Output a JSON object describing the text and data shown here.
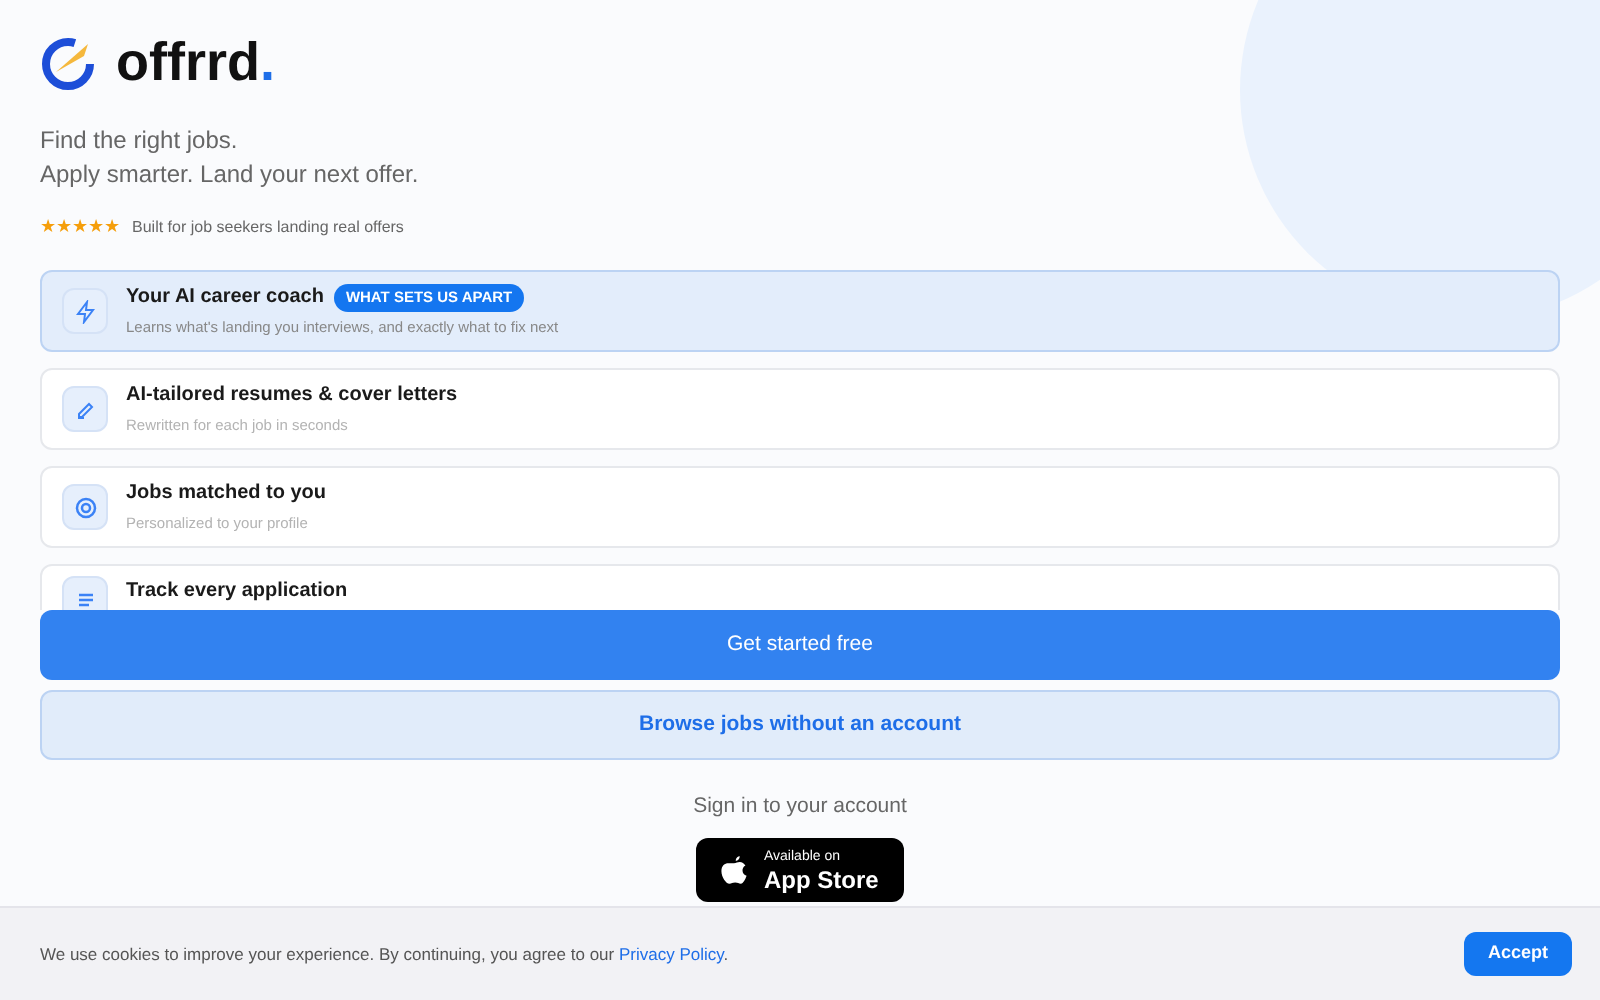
{
  "logo": {
    "name": "offrrd",
    "dot": "."
  },
  "tagline": [
    "Find the right jobs.",
    "Apply smarter. Land your next offer."
  ],
  "rating": {
    "stars": 5,
    "text": "Built for job seekers landing real offers"
  },
  "features": [
    {
      "kind": "bolt",
      "title": "Your AI career coach",
      "badge": "WHAT SETS US APART",
      "subtitle": "Learns what's landing you interviews, and exactly what to fix next",
      "selected": true
    },
    {
      "kind": "pen",
      "title": "AI-tailored resumes & cover letters",
      "subtitle": "Rewritten for each job in seconds",
      "selected": false
    },
    {
      "kind": "target",
      "title": "Jobs matched to you",
      "subtitle": "Personalized to your profile",
      "selected": false
    },
    {
      "kind": "track",
      "title": "Track every application",
      "selected": false
    }
  ],
  "primary_button": "Get started free",
  "secondary_button": "Browse jobs without an account",
  "sign_in_link": "Sign in to your account",
  "app_store": {
    "line1": "Available on",
    "line2": "App Store"
  },
  "cookie_banner": {
    "text": "We use cookies to improve your experience. By continuing, you agree to our ",
    "link": "Privacy Policy",
    "after": ".",
    "button": "Accept"
  }
}
